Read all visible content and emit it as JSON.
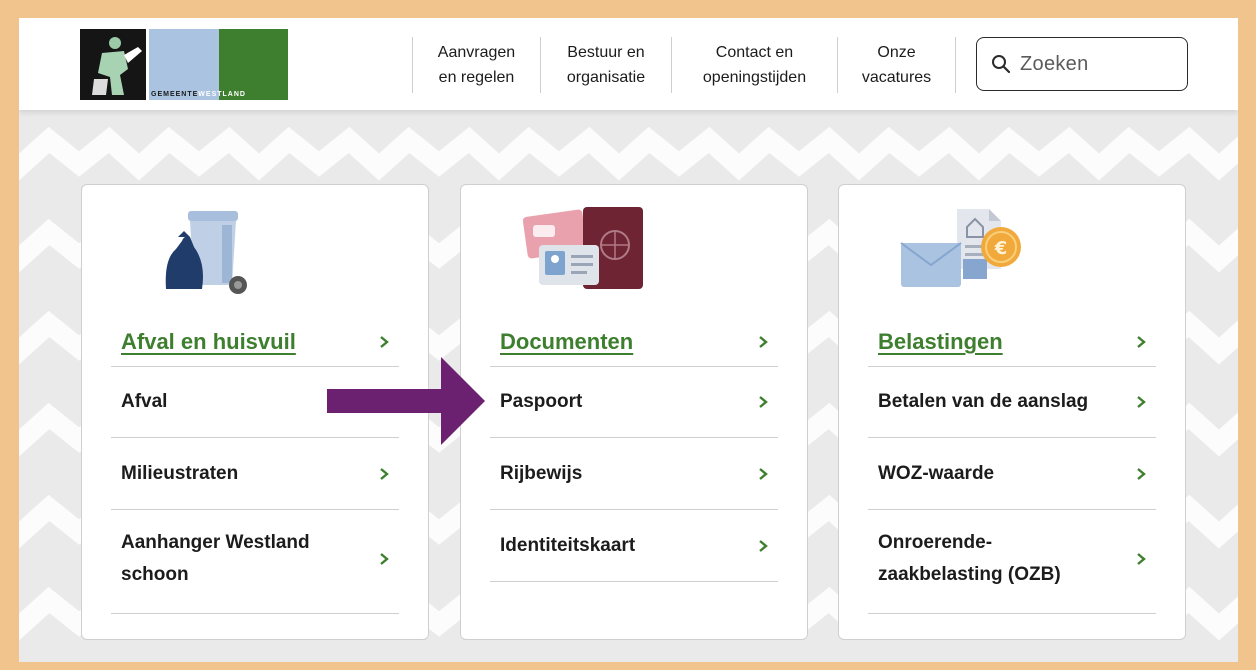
{
  "header": {
    "logo": {
      "text_left": "GEMEENTE",
      "text_right": "WESTLAND"
    },
    "nav": [
      {
        "line1": "Aanvragen",
        "line2": "en regelen"
      },
      {
        "line1": "Bestuur en",
        "line2": "organisatie"
      },
      {
        "line1": "Contact en",
        "line2": "openingstijden"
      },
      {
        "line1": "Onze",
        "line2": "vacatures"
      }
    ],
    "search": {
      "placeholder": "Zoeken",
      "icon": "search-icon"
    }
  },
  "cards": [
    {
      "icon": "waste-bin-icon",
      "title": "Afval en huisvuil",
      "items": [
        "Afval",
        "Milieustraten",
        "Aanhanger Westland schoon"
      ]
    },
    {
      "icon": "documents-icon",
      "title": "Documenten",
      "items": [
        "Paspoort",
        "Rijbewijs",
        "Identiteitskaart"
      ]
    },
    {
      "icon": "taxes-icon",
      "title": "Belastingen",
      "items": [
        "Betalen van de aanslag",
        "WOZ-waarde",
        "Onroerende-zaakbelasting (OZB)"
      ]
    }
  ],
  "annotation": {
    "icon": "purple-arrow-icon",
    "color": "#6b2070",
    "target": "Paspoort"
  },
  "colors": {
    "accent_green": "#3e7f2f",
    "frame_orange": "#f2c48d",
    "arrow_purple": "#6b2070"
  }
}
